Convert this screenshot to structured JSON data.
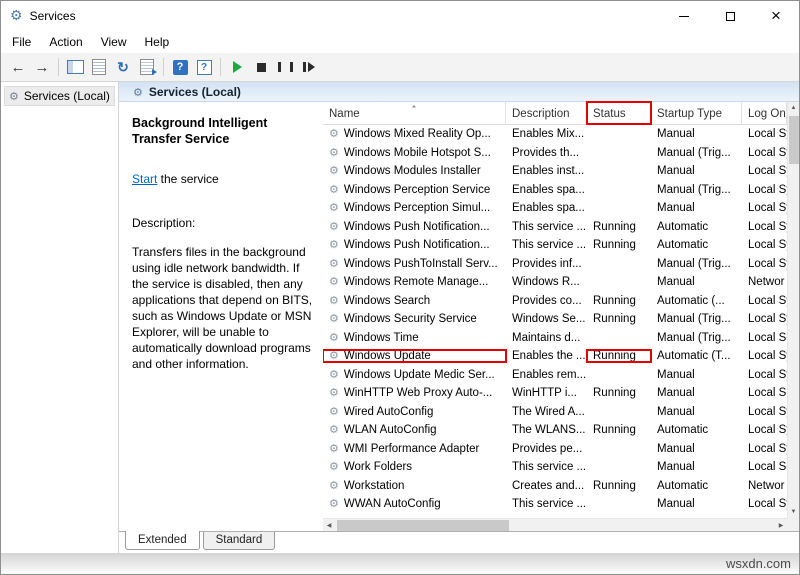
{
  "window": {
    "title": "Services"
  },
  "menubar": {
    "items": [
      "File",
      "Action",
      "View",
      "Help"
    ]
  },
  "toolbar": {
    "icons": [
      "back-icon",
      "forward-icon",
      "show-console-tree-icon",
      "properties-list-icon",
      "refresh-icon",
      "export-list-icon",
      "help-icon",
      "context-help-icon",
      "start-service-icon",
      "stop-service-icon",
      "pause-service-icon",
      "restart-service-icon"
    ]
  },
  "sidebar": {
    "root_label": "Services (Local)"
  },
  "panel": {
    "header": "Services (Local)"
  },
  "service_info": {
    "title": "Background Intelligent Transfer Service",
    "action_link": "Start",
    "action_suffix": " the service",
    "description_label": "Description:",
    "description": "Transfers files in the background using idle network bandwidth. If the service is disabled, then any applications that depend on BITS, such as Windows Update or MSN Explorer, will be unable to automatically download programs and other information."
  },
  "services": {
    "columns": [
      "Name",
      "Description",
      "Status",
      "Startup Type",
      "Log On"
    ],
    "highlighted_column_index": 2,
    "highlighted_row_index": 12,
    "rows": [
      [
        "Windows Mixed Reality Op...",
        "Enables Mix...",
        "",
        "Manual",
        "Local Sy"
      ],
      [
        "Windows Mobile Hotspot S...",
        "Provides th...",
        "",
        "Manual (Trig...",
        "Local Sy"
      ],
      [
        "Windows Modules Installer",
        "Enables inst...",
        "",
        "Manual",
        "Local Sy"
      ],
      [
        "Windows Perception Service",
        "Enables spa...",
        "",
        "Manual (Trig...",
        "Local Sy"
      ],
      [
        "Windows Perception Simul...",
        "Enables spa...",
        "",
        "Manual",
        "Local Sy"
      ],
      [
        "Windows Push Notification...",
        "This service ...",
        "Running",
        "Automatic",
        "Local Sy"
      ],
      [
        "Windows Push Notification...",
        "This service ...",
        "Running",
        "Automatic",
        "Local Sy"
      ],
      [
        "Windows PushToInstall Serv...",
        "Provides inf...",
        "",
        "Manual (Trig...",
        "Local Sy"
      ],
      [
        "Windows Remote Manage...",
        "Windows R...",
        "",
        "Manual",
        "Networ"
      ],
      [
        "Windows Search",
        "Provides co...",
        "Running",
        "Automatic (...",
        "Local Sy"
      ],
      [
        "Windows Security Service",
        "Windows Se...",
        "Running",
        "Manual (Trig...",
        "Local Sy"
      ],
      [
        "Windows Time",
        "Maintains d...",
        "",
        "Manual (Trig...",
        "Local Se"
      ],
      [
        "Windows Update",
        "Enables the ...",
        "Running",
        "Automatic (T...",
        "Local Sy"
      ],
      [
        "Windows Update Medic Ser...",
        "Enables rem...",
        "",
        "Manual",
        "Local Sy"
      ],
      [
        "WinHTTP Web Proxy Auto-...",
        "WinHTTP i...",
        "Running",
        "Manual",
        "Local Se"
      ],
      [
        "Wired AutoConfig",
        "The Wired A...",
        "",
        "Manual",
        "Local Sy"
      ],
      [
        "WLAN AutoConfig",
        "The WLANS...",
        "Running",
        "Automatic",
        "Local Sy"
      ],
      [
        "WMI Performance Adapter",
        "Provides pe...",
        "",
        "Manual",
        "Local Sy"
      ],
      [
        "Work Folders",
        "This service ...",
        "",
        "Manual",
        "Local Se"
      ],
      [
        "Workstation",
        "Creates and...",
        "Running",
        "Automatic",
        "Networ"
      ],
      [
        "WWAN AutoConfig",
        "This service ...",
        "",
        "Manual",
        "Local Sy"
      ]
    ]
  },
  "footer_tabs": [
    "Extended",
    "Standard"
  ],
  "watermark": "wsxdn.com",
  "colors": {
    "annotation": "#e40000",
    "link": "#0066cc",
    "running_status": "Running"
  }
}
